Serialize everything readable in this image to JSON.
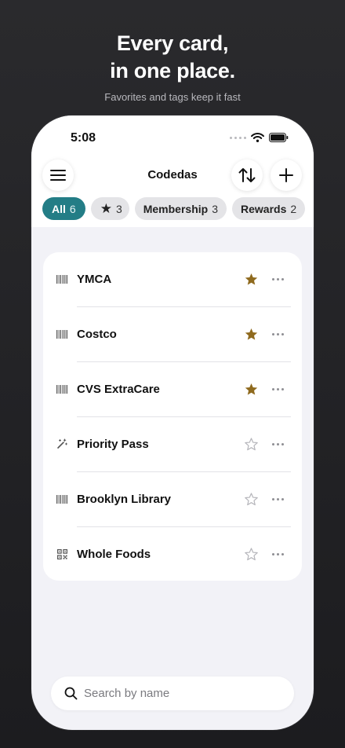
{
  "hero": {
    "title_line1": "Every card,",
    "title_line2": "in one place.",
    "subtitle": "Favorites and tags keep it fast"
  },
  "status": {
    "time": "5:08"
  },
  "nav": {
    "title": "Codedas"
  },
  "filters": [
    {
      "label": "All",
      "count": "6",
      "active": true
    },
    {
      "label": "★",
      "count": "3",
      "active": false
    },
    {
      "label": "Membership",
      "count": "3",
      "active": false
    },
    {
      "label": "Rewards",
      "count": "2",
      "active": false
    }
  ],
  "cards": [
    {
      "name": "YMCA",
      "icon": "barcode-icon",
      "favorite": true
    },
    {
      "name": "Costco",
      "icon": "barcode-icon",
      "favorite": true
    },
    {
      "name": "CVS ExtraCare",
      "icon": "barcode-icon",
      "favorite": true
    },
    {
      "name": "Priority Pass",
      "icon": "magic-wand-icon",
      "favorite": false
    },
    {
      "name": "Brooklyn Library",
      "icon": "barcode-icon",
      "favorite": false
    },
    {
      "name": "Whole Foods",
      "icon": "qr-code-icon",
      "favorite": false
    }
  ],
  "search": {
    "placeholder": "Search by name",
    "value": ""
  },
  "colors": {
    "accent": "#237d86",
    "star_filled": "#8f6a1e",
    "star_empty": "#b5b5ba"
  }
}
